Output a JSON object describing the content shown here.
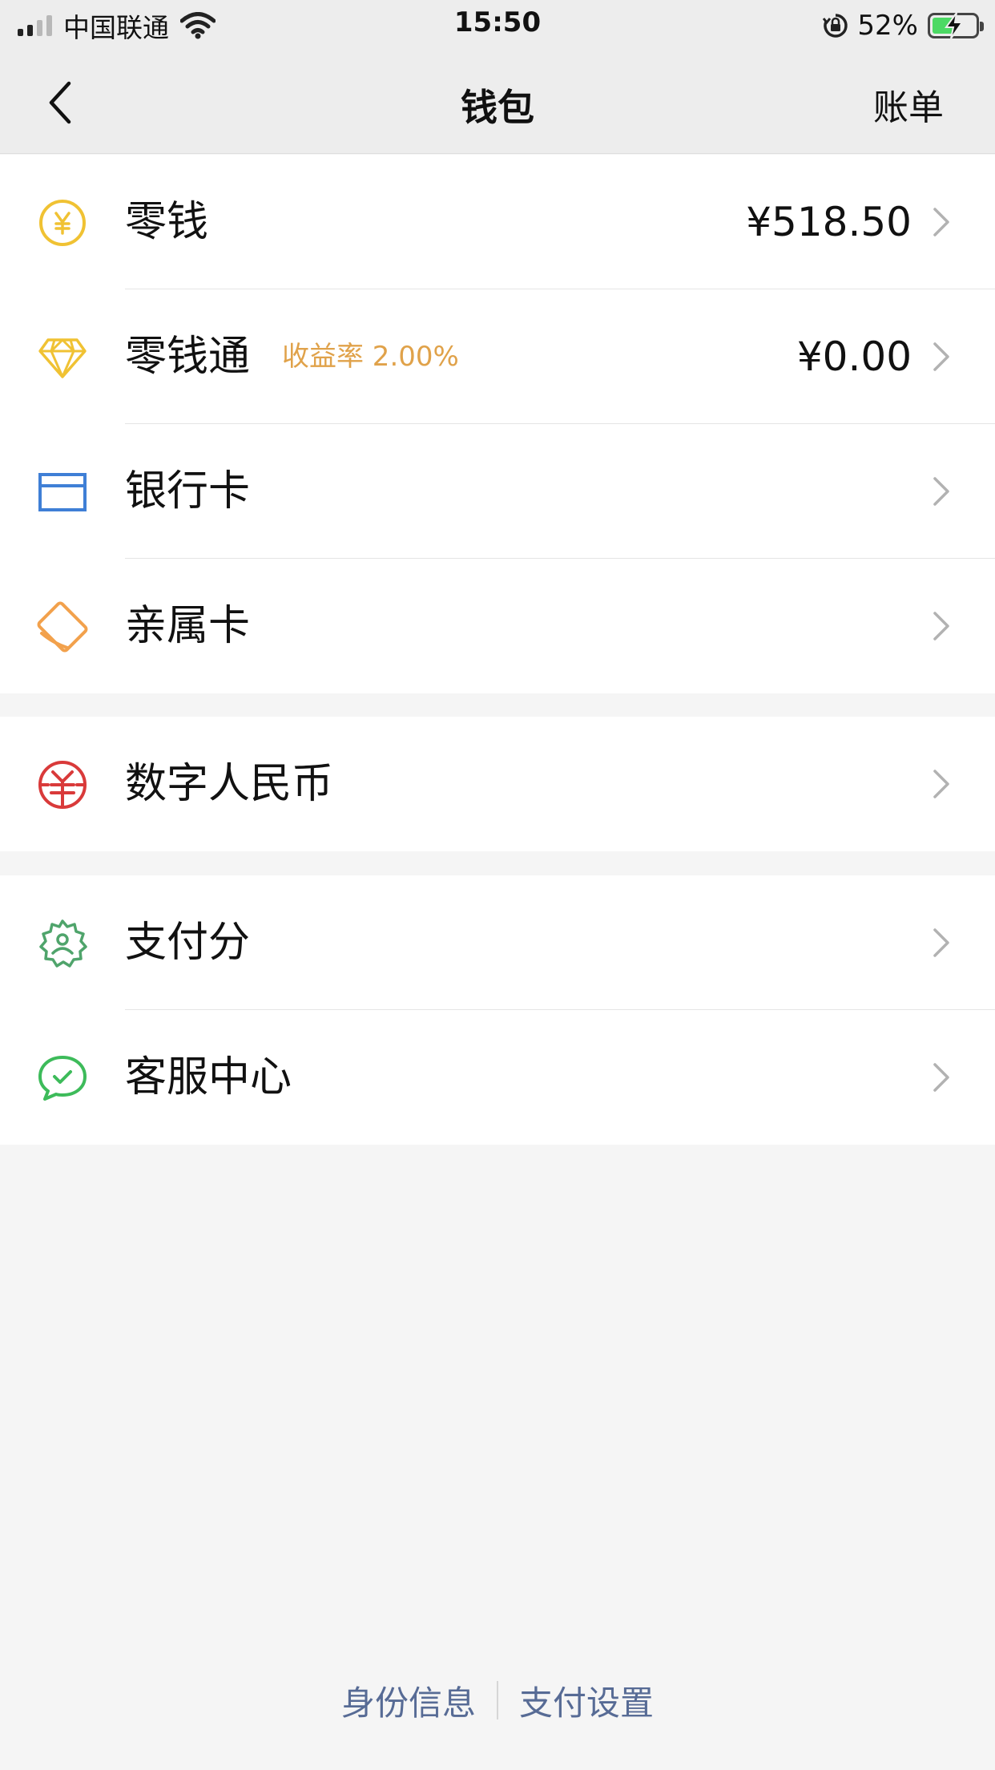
{
  "status_bar": {
    "carrier": "中国联通",
    "time": "15:50",
    "battery_percent": "52%",
    "battery_level": 0.52
  },
  "nav": {
    "title": "钱包",
    "right_action": "账单"
  },
  "groups": [
    {
      "items": [
        {
          "label": "零钱",
          "value": "¥518.50",
          "icon": "yuan-coin-icon",
          "color": "#f0c233"
        },
        {
          "label": "零钱通",
          "sub": "收益率 2.00%",
          "value": "¥0.00",
          "icon": "diamond-icon",
          "color": "#f0c233"
        },
        {
          "label": "银行卡",
          "icon": "bank-card-icon",
          "color": "#3f7fd6"
        },
        {
          "label": "亲属卡",
          "icon": "family-card-icon",
          "color": "#f2a14c"
        }
      ]
    },
    {
      "items": [
        {
          "label": "数字人民币",
          "icon": "digital-rmb-icon",
          "color": "#d93a3a"
        }
      ]
    },
    {
      "items": [
        {
          "label": "支付分",
          "icon": "pay-score-icon",
          "color": "#4fa46b"
        },
        {
          "label": "客服中心",
          "icon": "customer-service-icon",
          "color": "#3dbb5a"
        }
      ]
    }
  ],
  "footer": {
    "identity_info": "身份信息",
    "pay_settings": "支付设置"
  },
  "colors": {
    "link": "#576b95",
    "yield_text": "#e0a24a",
    "nav_background": "#ededed",
    "page_background": "#f5f5f5"
  }
}
